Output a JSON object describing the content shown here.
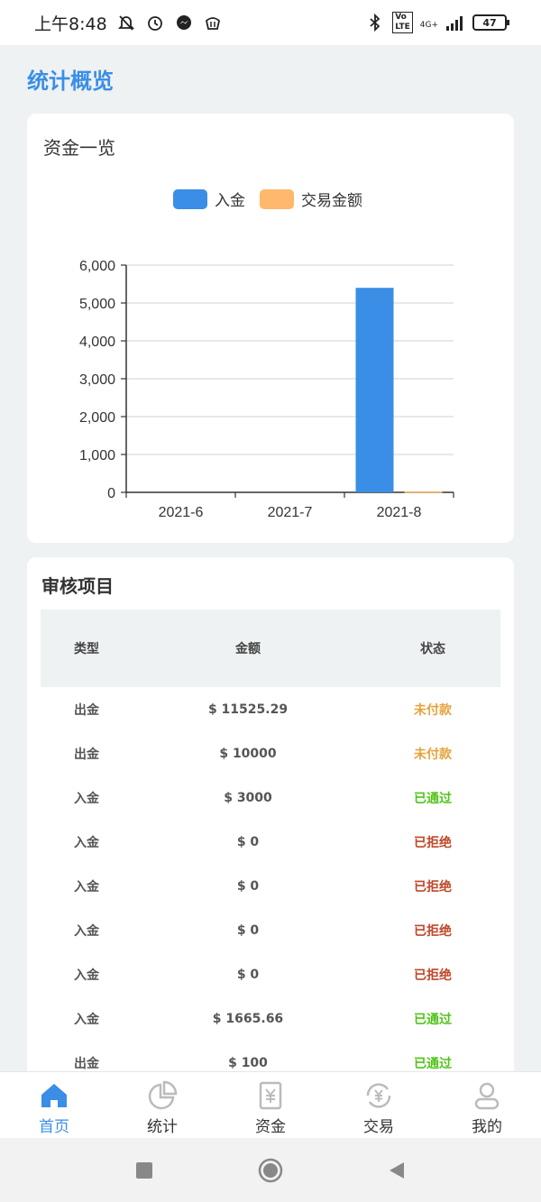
{
  "status_bar": {
    "time": "上午8:48",
    "network": "4G+",
    "battery": "47"
  },
  "page_title": "统计概览",
  "fund_card": {
    "title": "资金一览",
    "legend": [
      {
        "label": "入金",
        "color": "#3a8ee6"
      },
      {
        "label": "交易金额",
        "color": "#ffb86c"
      }
    ]
  },
  "chart_data": {
    "type": "bar",
    "categories": [
      "2021-6",
      "2021-7",
      "2021-8"
    ],
    "series": [
      {
        "name": "入金",
        "values": [
          0,
          0,
          5400
        ],
        "color": "#3a8ee6"
      },
      {
        "name": "交易金额",
        "values": [
          0,
          0,
          20
        ],
        "color": "#ffb86c"
      }
    ],
    "yticks": [
      "0",
      "1,000",
      "2,000",
      "3,000",
      "4,000",
      "5,000",
      "6,000"
    ],
    "ylim": [
      0,
      6000
    ],
    "grid": true,
    "legend_position": "top-center"
  },
  "review_card": {
    "title": "审核项目",
    "headers": {
      "type": "类型",
      "amount": "金额",
      "status": "状态"
    },
    "rows": [
      {
        "type": "出金",
        "amount": "$ 11525.29",
        "status": "未付款",
        "state": "unpaid"
      },
      {
        "type": "出金",
        "amount": "$ 10000",
        "status": "未付款",
        "state": "unpaid"
      },
      {
        "type": "入金",
        "amount": "$ 3000",
        "status": "已通过",
        "state": "pass"
      },
      {
        "type": "入金",
        "amount": "$ 0",
        "status": "已拒绝",
        "state": "reject"
      },
      {
        "type": "入金",
        "amount": "$ 0",
        "status": "已拒绝",
        "state": "reject"
      },
      {
        "type": "入金",
        "amount": "$ 0",
        "status": "已拒绝",
        "state": "reject"
      },
      {
        "type": "入金",
        "amount": "$ 0",
        "status": "已拒绝",
        "state": "reject"
      },
      {
        "type": "入金",
        "amount": "$ 1665.66",
        "status": "已通过",
        "state": "pass"
      },
      {
        "type": "出金",
        "amount": "$ 100",
        "status": "已通过",
        "state": "pass"
      }
    ]
  },
  "tabbar": {
    "items": [
      {
        "label": "首页",
        "icon": "home-icon"
      },
      {
        "label": "统计",
        "icon": "pie-chart-icon"
      },
      {
        "label": "资金",
        "icon": "wallet-yuan-icon"
      },
      {
        "label": "交易",
        "icon": "exchange-yuan-icon"
      },
      {
        "label": "我的",
        "icon": "user-icon"
      }
    ],
    "active_color": "#3a8ee6"
  }
}
